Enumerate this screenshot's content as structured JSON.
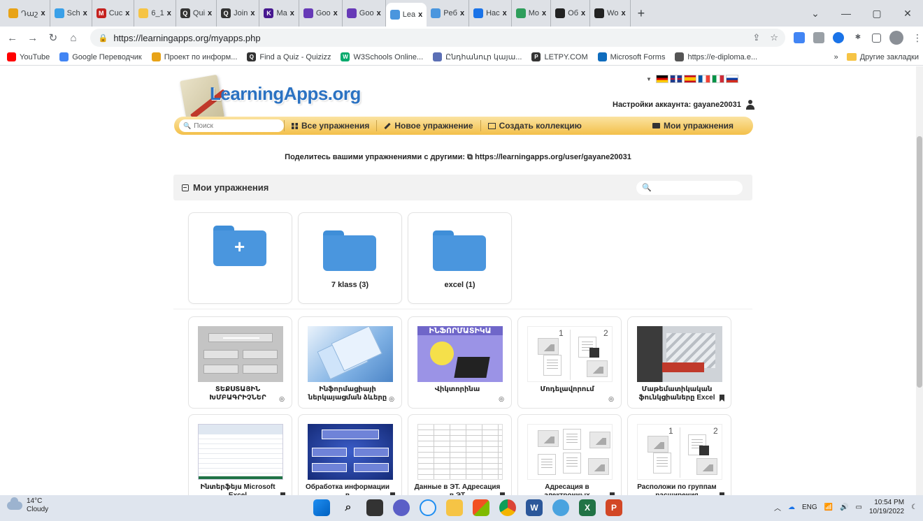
{
  "browser": {
    "tabs": [
      {
        "label": "Դաշ",
        "color": "#e8a317"
      },
      {
        "label": "Sch",
        "color": "#3aa0e8"
      },
      {
        "label": "Cuc",
        "color": "#c5221f",
        "glyph": "M"
      },
      {
        "label": "6_1",
        "color": "#f6c445"
      },
      {
        "label": "Qui",
        "color": "#333333",
        "glyph": "Q"
      },
      {
        "label": "Join",
        "color": "#333333",
        "glyph": "Q"
      },
      {
        "label": "Ma",
        "color": "#46178f",
        "glyph": "K"
      },
      {
        "label": "Goo",
        "color": "#673ab7"
      },
      {
        "label": "Goo",
        "color": "#673ab7"
      },
      {
        "label": "Lea",
        "color": "#4a96de",
        "active": true
      },
      {
        "label": "Peб",
        "color": "#4a96de"
      },
      {
        "label": "Нас",
        "color": "#1a73e8"
      },
      {
        "label": "Mo",
        "color": "#2e9e5b"
      },
      {
        "label": "Об",
        "color": "#222222"
      },
      {
        "label": "Wo",
        "color": "#222222"
      }
    ],
    "close_glyph": "x",
    "new_tab": "+",
    "address": "https://learningapps.org/myapps.php",
    "bookmarks": [
      {
        "label": "YouTube",
        "color": "#ff0000"
      },
      {
        "label": "Google Переводчик",
        "color": "#4285f4"
      },
      {
        "label": "Проект по информ...",
        "color": "#e8a317"
      },
      {
        "label": "Find a Quiz - Quizizz",
        "color": "#333333",
        "glyph": "Q"
      },
      {
        "label": "W3Schools Online...",
        "color": "#04aa6d",
        "glyph": "W"
      },
      {
        "label": "Ընդհանուր կայա...",
        "color": "#5b6fb5"
      },
      {
        "label": "LETPY.COM",
        "color": "#333333",
        "glyph": "P"
      },
      {
        "label": "Microsoft Forms",
        "color": "#0f6cbd"
      },
      {
        "label": "https://e-diploma.e...",
        "color": "#555555"
      }
    ],
    "bookmarks_more": "»",
    "other_bookmarks": "Другие закладки"
  },
  "site": {
    "logo_text": "LearningApps.org",
    "account_label": "Настройки аккаунта: gayane20031",
    "search_placeholder": "Поиск",
    "nav": {
      "all_exercises": "Все упражнения",
      "new_exercise": "Новое упражнение",
      "create_collection": "Создать коллекцию",
      "my_exercises": "Мои упражнения"
    },
    "share_text": "Поделитесь вашими упражнениями с другими:",
    "share_url": "https://learningapps.org/user/gayane20031",
    "panel_title": "Мои упражнения",
    "folders": [
      {
        "label": "",
        "kind": "new"
      },
      {
        "label": "7 klass (3)",
        "kind": "folder"
      },
      {
        "label": "excel (1)",
        "kind": "folder"
      }
    ],
    "apps": [
      {
        "label": "ՏԵՔՍՏԱՅԻՆ ԽՄԲԱԳՐԻՉՆԵՐ",
        "thumb": "grey",
        "status": "hidden"
      },
      {
        "label": "Ինֆորմացիայի ներկայացման ձևերը",
        "thumb": "blue",
        "status": "hidden"
      },
      {
        "label": "Վիկտորինա",
        "thumb": "yellow",
        "thumb_title": "ԻՆՖՈՐՄԱՏԻԿԱ",
        "status": "hidden"
      },
      {
        "label": "Մոդելավորում",
        "thumb": "pairs",
        "status": "hidden"
      },
      {
        "label": "Մաթեմատիկական ֆունկցիաները Excel",
        "thumb": "photo",
        "status": "bookmark"
      },
      {
        "label": "Ինտերֆեյս Microsoft Excel",
        "thumb": "excel",
        "status": "bookmark"
      },
      {
        "label": "Обработка информации в",
        "thumb": "dark",
        "status": "bookmark"
      },
      {
        "label": "Данные в ЭТ. Адресация в ЭТ",
        "thumb": "table",
        "status": "bookmark"
      },
      {
        "label": "Адресация в электронных",
        "thumb": "match",
        "status": "bookmark"
      },
      {
        "label": "Расположи по группам расширения",
        "thumb": "pairs",
        "status": "bookmark"
      }
    ]
  },
  "taskbar": {
    "temperature": "14°C",
    "weather": "Cloudy",
    "language": "ENG",
    "time": "10:54 PM",
    "date": "10/19/2022"
  }
}
